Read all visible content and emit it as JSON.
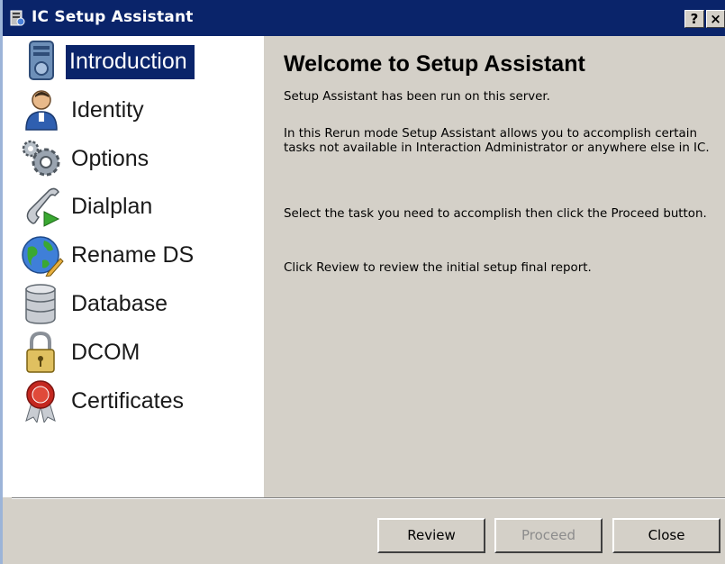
{
  "window": {
    "title": "IC Setup Assistant",
    "help_button": "?",
    "close_button": "×"
  },
  "sidebar": {
    "items": [
      {
        "label": "Introduction",
        "icon": "server-tower-icon",
        "selected": true
      },
      {
        "label": "Identity",
        "icon": "user-icon",
        "selected": false
      },
      {
        "label": "Options",
        "icon": "gears-icon",
        "selected": false
      },
      {
        "label": "Dialplan",
        "icon": "phone-handset-icon",
        "selected": false
      },
      {
        "label": "Rename DS",
        "icon": "globe-pencil-icon",
        "selected": false
      },
      {
        "label": "Database",
        "icon": "database-icon",
        "selected": false
      },
      {
        "label": "DCOM",
        "icon": "padlock-icon",
        "selected": false
      },
      {
        "label": "Certificates",
        "icon": "certificate-seal-icon",
        "selected": false
      }
    ]
  },
  "main": {
    "title": "Welcome to Setup Assistant",
    "paragraphs": [
      "Setup Assistant has been run on this server.",
      "In this Rerun mode Setup Assistant allows you to accomplish certain tasks not available in Interaction Administrator or anywhere else in IC.",
      "Select the task you need to accomplish then click the Proceed button.",
      "Click Review to review the initial setup final report."
    ]
  },
  "footer": {
    "review_label": "Review",
    "proceed_label": "Proceed",
    "close_label": "Close",
    "proceed_disabled": true
  },
  "colors": {
    "title_bar": "#0a246a",
    "selection": "#0a246a",
    "dialog_face": "#d4d0c8"
  }
}
